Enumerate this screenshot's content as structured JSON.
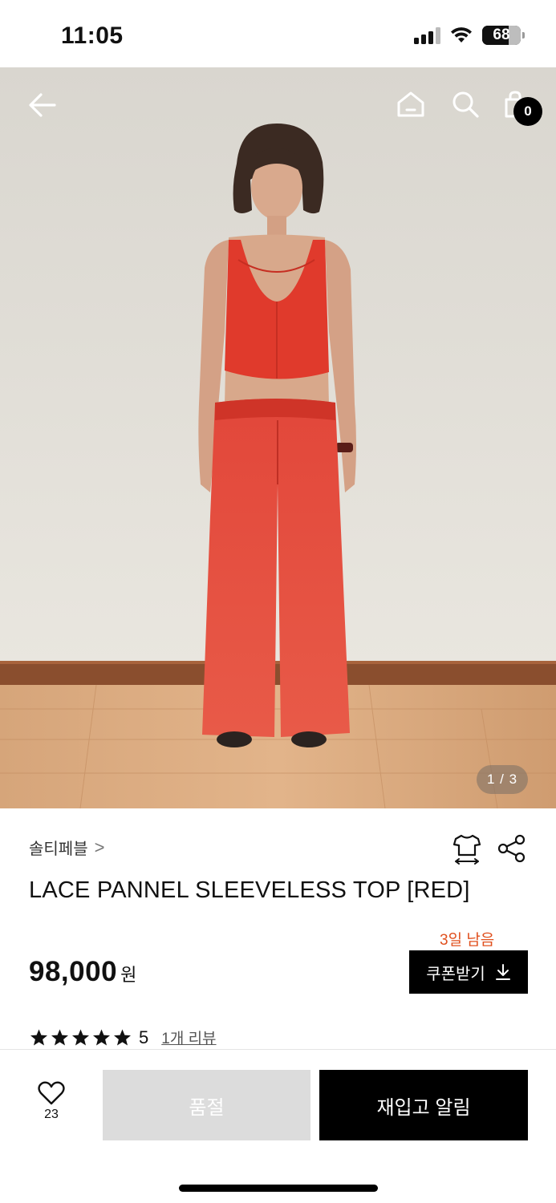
{
  "status_bar": {
    "time": "11:05",
    "battery": "68",
    "battery_level": 0.68
  },
  "hero": {
    "cart_count": "0",
    "page_indicator": "1 / 3",
    "icons": [
      "back-arrow-icon",
      "home-icon",
      "search-icon",
      "shopping-bag-icon"
    ]
  },
  "product": {
    "brand": "솔티페블",
    "brand_chevron": ">",
    "title": "LACE PANNEL SLEEVELESS TOP [RED]",
    "coupon_note": "3일 남음",
    "price": "98,000",
    "price_unit": "원",
    "coupon_label": "쿠폰받기",
    "rating": "5",
    "stars_filled": 5,
    "review_link": "1개 리뷰"
  },
  "bottom_bar": {
    "like_count": "23",
    "soldout_label": "품절",
    "restock_label": "재입고 알림"
  },
  "colors": {
    "accent_orange": "#e0501e",
    "black": "#000000",
    "soldout_gray": "#dcdcdc",
    "garment_red": "#e03a2c"
  }
}
